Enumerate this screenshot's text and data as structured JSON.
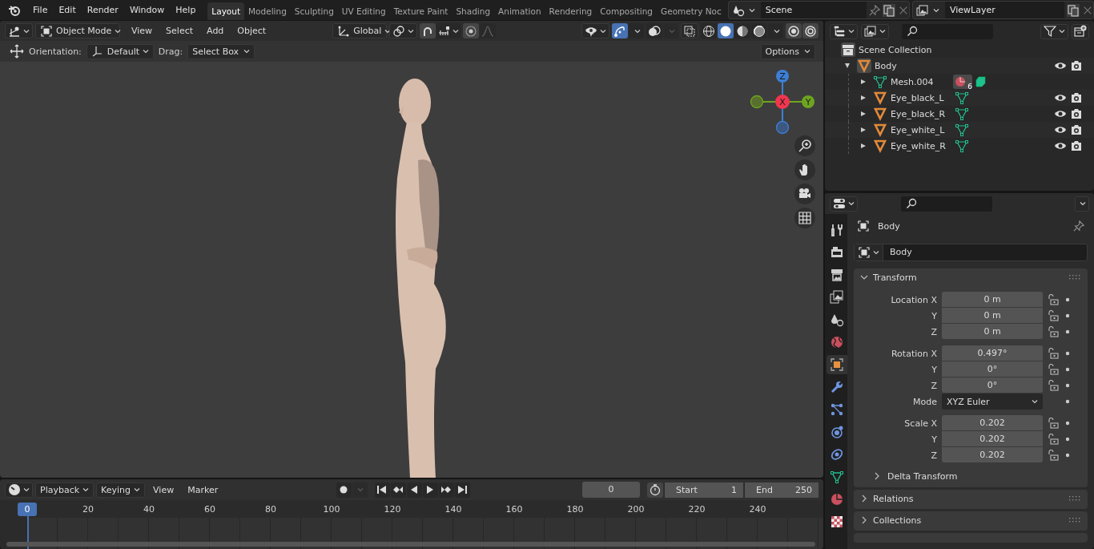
{
  "menu": [
    "File",
    "Edit",
    "Render",
    "Window",
    "Help"
  ],
  "workspaces": [
    {
      "label": "Layout",
      "selected": true
    },
    {
      "label": "Modeling",
      "selected": false
    },
    {
      "label": "Sculpting",
      "selected": false
    },
    {
      "label": "UV Editing",
      "selected": false
    },
    {
      "label": "Texture Paint",
      "selected": false
    },
    {
      "label": "Shading",
      "selected": false
    },
    {
      "label": "Animation",
      "selected": false
    },
    {
      "label": "Rendering",
      "selected": false
    },
    {
      "label": "Compositing",
      "selected": false
    },
    {
      "label": "Geometry Noc",
      "selected": false
    }
  ],
  "scene": "Scene",
  "view_layer": "ViewLayer",
  "viewport": {
    "mode": "Object Mode",
    "menus": [
      "View",
      "Select",
      "Add",
      "Object"
    ],
    "orientation": "Global",
    "gizmos_on": true,
    "shading": [
      {
        "kind": "wireframe",
        "selected": false
      },
      {
        "kind": "solid",
        "selected": true
      },
      {
        "kind": "material",
        "selected": false
      },
      {
        "kind": "rendered",
        "selected": false
      }
    ],
    "tool_settings": {
      "orientation_label": "Orientation:",
      "orientation": "Default",
      "drag_label": "Drag:",
      "drag": "Select Box",
      "options": "Options"
    },
    "gizmo": {
      "x": "X",
      "y": "Y",
      "z": "Z"
    }
  },
  "outliner": {
    "root": "Scene Collection",
    "items": [
      {
        "name": "Body",
        "kind": "object",
        "expanded": true,
        "children": [
          {
            "name": "Mesh.004",
            "kind": "mesh",
            "expanded": false,
            "badge": "6"
          },
          {
            "name": "Eye_black_L",
            "kind": "object",
            "expanded": false
          },
          {
            "name": "Eye_black_R",
            "kind": "object",
            "expanded": false
          },
          {
            "name": "Eye_white_L",
            "kind": "object",
            "expanded": false
          },
          {
            "name": "Eye_white_R",
            "kind": "object",
            "expanded": false
          }
        ]
      }
    ]
  },
  "properties": {
    "tabs": [
      {
        "kind": "tools",
        "selected": false
      },
      {
        "kind": "render",
        "selected": false
      },
      {
        "kind": "output",
        "selected": false
      },
      {
        "kind": "view_layer",
        "selected": false
      },
      {
        "kind": "scene",
        "selected": false
      },
      {
        "kind": "world",
        "selected": false
      },
      {
        "kind": "object",
        "selected": true
      },
      {
        "kind": "modifiers",
        "selected": false
      },
      {
        "kind": "particles",
        "selected": false
      },
      {
        "kind": "physics",
        "selected": false
      },
      {
        "kind": "constraints",
        "selected": false
      },
      {
        "kind": "data",
        "selected": false
      },
      {
        "kind": "material",
        "selected": false
      },
      {
        "kind": "texture",
        "selected": false
      }
    ],
    "object_name": "Body",
    "data_name": "Body",
    "panels": [
      {
        "title": "Transform",
        "expanded": true,
        "groups": [
          [
            {
              "label": "Location X",
              "value": "0 m",
              "kind": "number"
            },
            {
              "label": "Y",
              "value": "0 m",
              "kind": "number"
            },
            {
              "label": "Z",
              "value": "0 m",
              "kind": "number"
            }
          ],
          [
            {
              "label": "Rotation X",
              "value": "0.497°",
              "kind": "number"
            },
            {
              "label": "Y",
              "value": "0°",
              "kind": "number"
            },
            {
              "label": "Z",
              "value": "0°",
              "kind": "number"
            },
            {
              "label": "Mode",
              "value": "XYZ Euler",
              "kind": "dropdown"
            }
          ],
          [
            {
              "label": "Scale X",
              "value": "0.202",
              "kind": "number"
            },
            {
              "label": "Y",
              "value": "0.202",
              "kind": "number"
            },
            {
              "label": "Z",
              "value": "0.202",
              "kind": "number"
            }
          ]
        ],
        "subpanels": [
          {
            "title": "Delta Transform",
            "expanded": false
          }
        ]
      },
      {
        "title": "Relations",
        "expanded": false
      },
      {
        "title": "Collections",
        "expanded": false
      }
    ]
  },
  "timeline": {
    "menus": [
      {
        "label": "Playback",
        "kind": "dropdown"
      },
      {
        "label": "Keying",
        "kind": "dropdown"
      },
      {
        "label": "View",
        "kind": "menu"
      },
      {
        "label": "Marker",
        "kind": "menu"
      }
    ],
    "current_frame": "0",
    "start_label": "Start",
    "start": "1",
    "end_label": "End",
    "end": "250",
    "cursor": "0",
    "ruler": [
      "20",
      "40",
      "60",
      "80",
      "100",
      "120",
      "140",
      "160",
      "180",
      "200",
      "220",
      "240"
    ]
  }
}
